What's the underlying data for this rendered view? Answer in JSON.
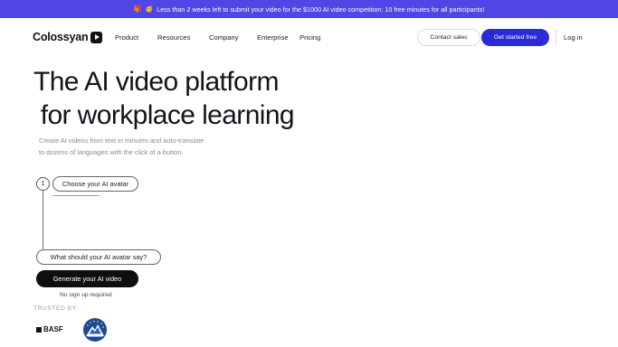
{
  "banner": {
    "emoji1": "🎁",
    "emoji2": "🥳",
    "text": "Less than 2 weeks left to submit your video for the $1000 AI video competition: 10 free minutes for all participants!"
  },
  "nav": {
    "logo_text": "Colossyan",
    "items": [
      {
        "label": "Product",
        "chevron": "⌄"
      },
      {
        "label": "Resources",
        "chevron": "⌄"
      },
      {
        "label": "Company",
        "chevron": "⌄"
      },
      {
        "label": "Enterprise",
        "chevron": "⌄"
      },
      {
        "label": "Pricing"
      }
    ],
    "contact_sales": "Contact sales",
    "get_started": "Get started free",
    "login": "Log in"
  },
  "hero": {
    "title": "The AI video platform\n for workplace learning",
    "subtitle_line1": "Create AI videos from text in minutes and auto-translate",
    "subtitle_line2": "to dozens of languages with the click of a button."
  },
  "steps": {
    "step1_number": "1",
    "step1_label": "Choose your AI avatar",
    "step2_label": "What should your AI avatar say?",
    "generate_label": "Generate your AI video",
    "no_signup": "No sign up required"
  },
  "trusted": {
    "label": "TRUSTED BY:",
    "logos": [
      {
        "name": "BASF",
        "text": "BASF"
      },
      {
        "name": "Paramount",
        "text": "Paramount"
      }
    ]
  },
  "colors": {
    "banner_bg": "#4f46e5",
    "primary_button": "#2b2bd6",
    "generate_button": "#0f0f12"
  }
}
